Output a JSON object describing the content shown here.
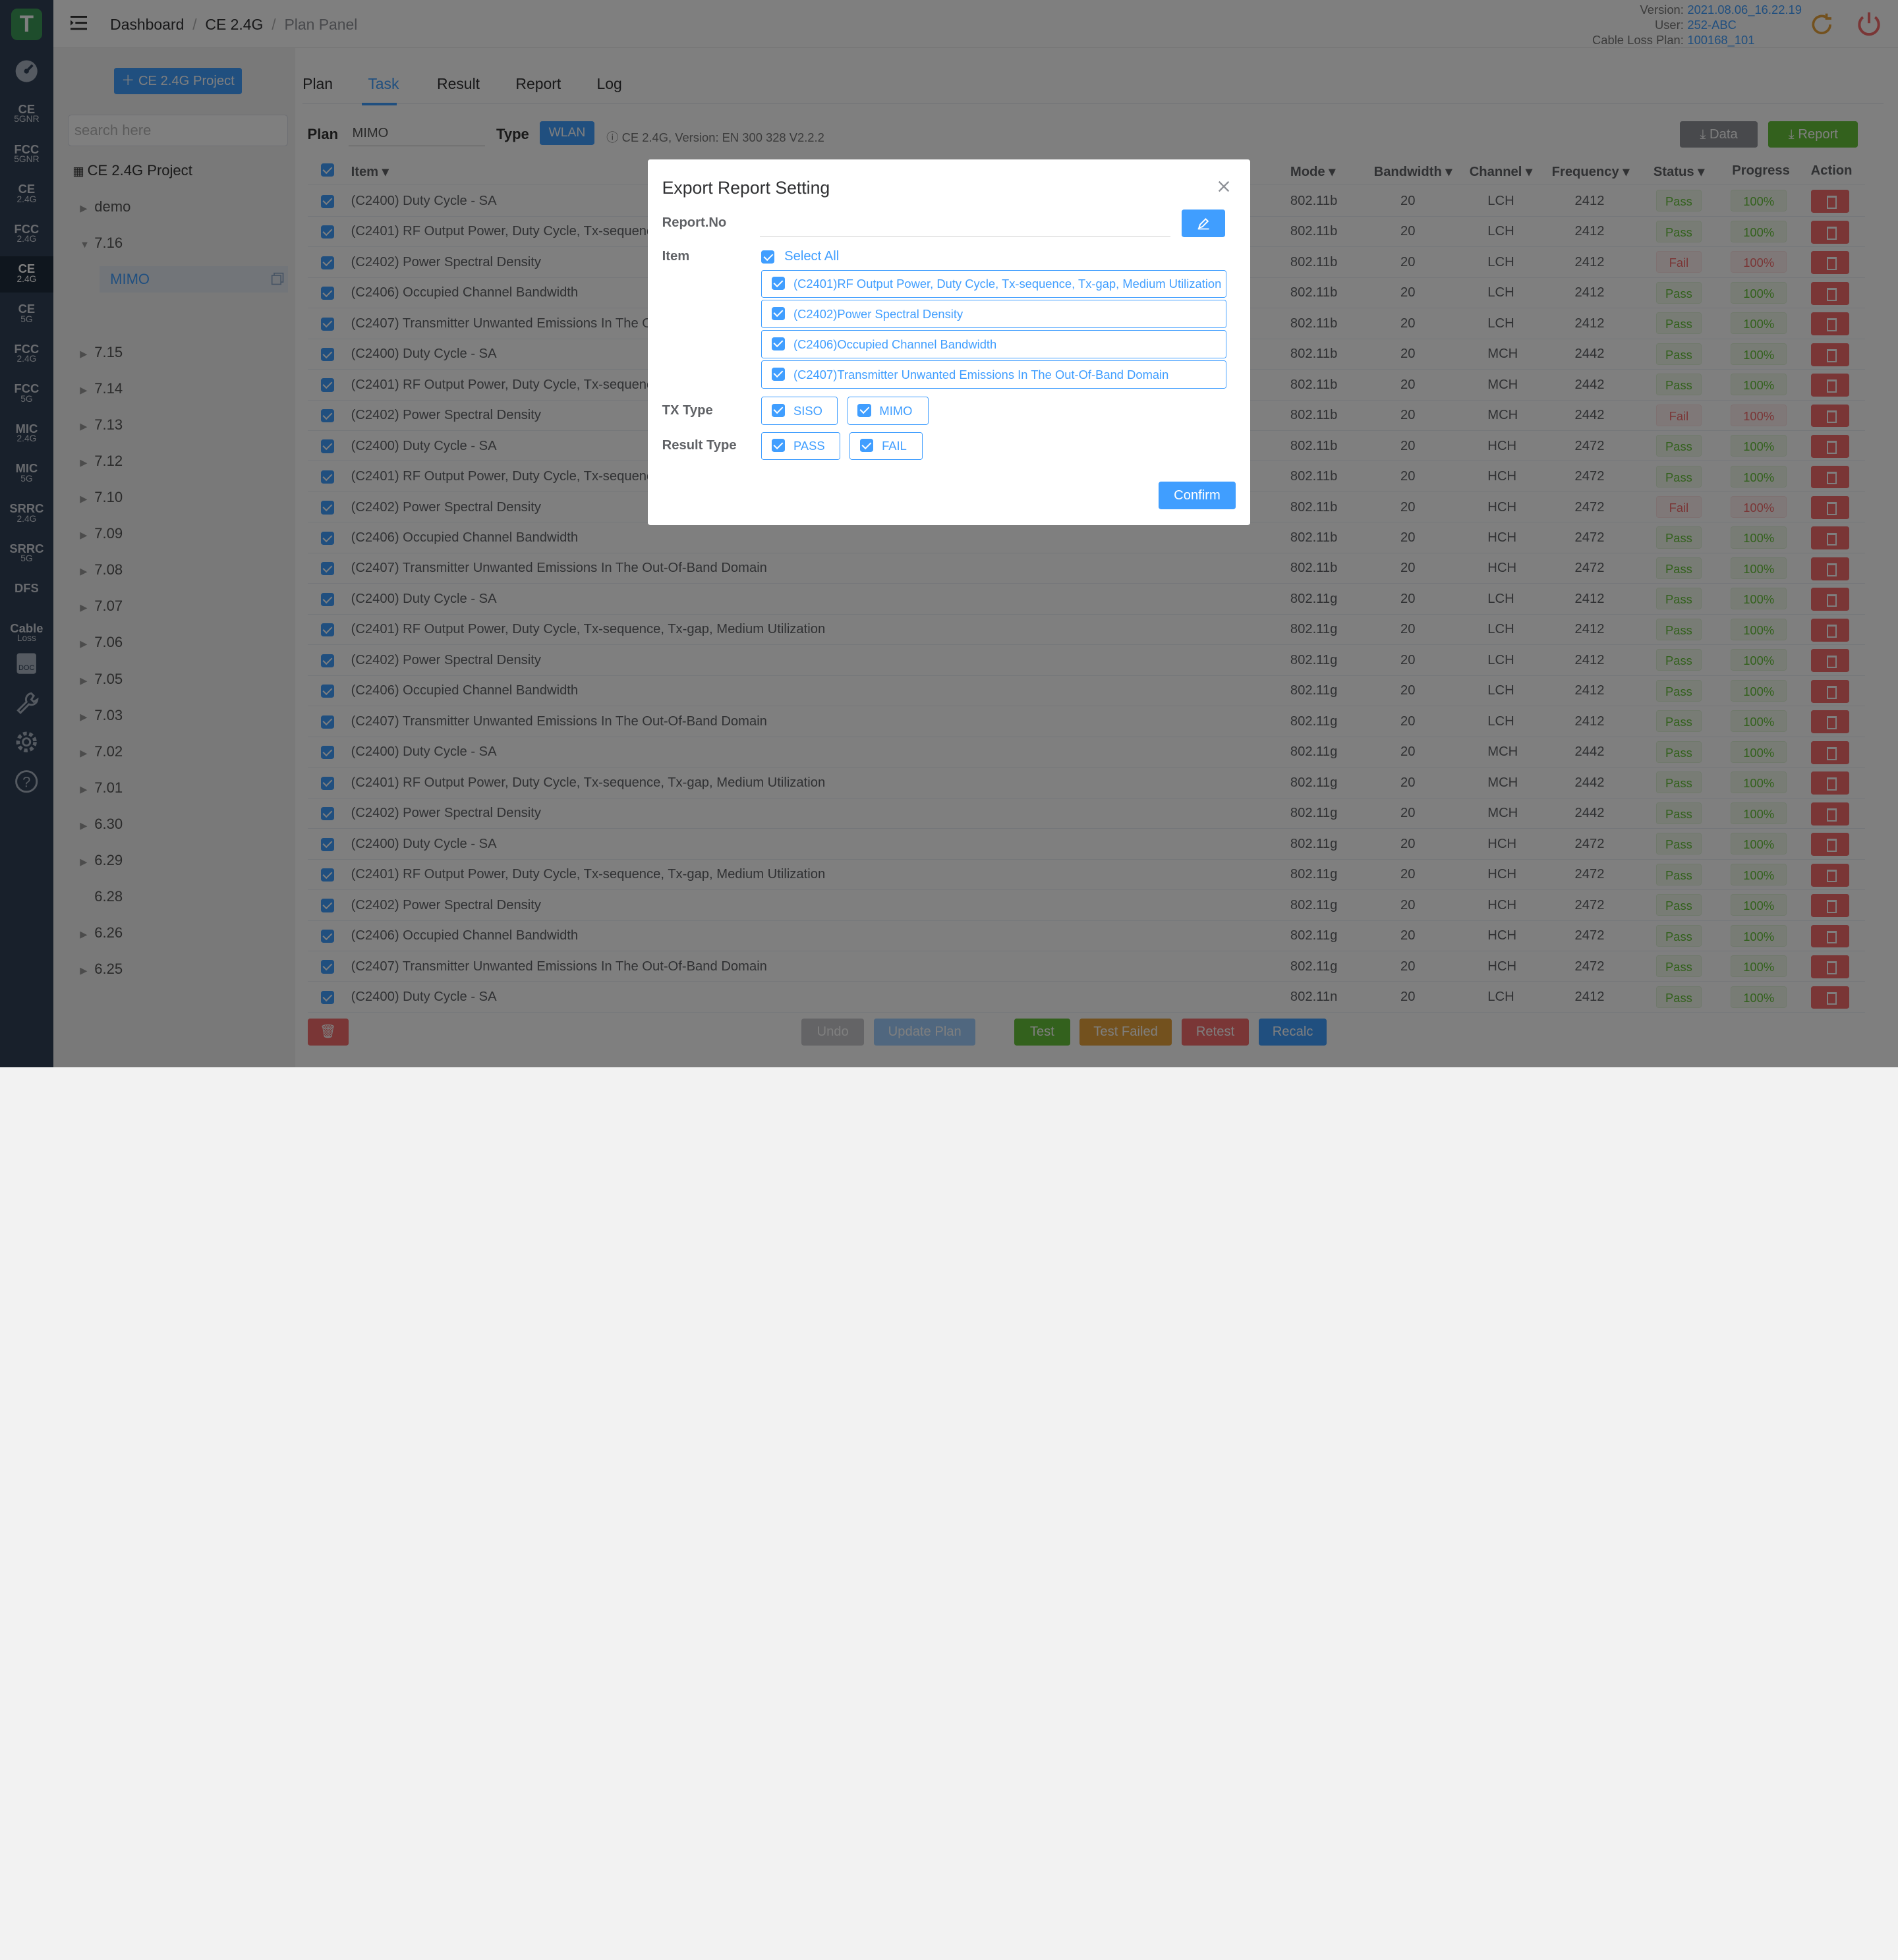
{
  "app": {
    "logo_letter": "T"
  },
  "rail": {
    "items": [
      {
        "main": "CE",
        "sub": "5GNR"
      },
      {
        "main": "FCC",
        "sub": "5GNR"
      },
      {
        "main": "CE",
        "sub": "2.4G"
      },
      {
        "main": "FCC",
        "sub": "2.4G"
      },
      {
        "main": "CE",
        "sub": "2.4G"
      },
      {
        "main": "CE",
        "sub": "5G"
      },
      {
        "main": "FCC",
        "sub": "2.4G"
      },
      {
        "main": "FCC",
        "sub": "5G"
      },
      {
        "main": "MIC",
        "sub": "2.4G"
      },
      {
        "main": "MIC",
        "sub": "5G"
      },
      {
        "main": "SRRC",
        "sub": "2.4G"
      },
      {
        "main": "SRRC",
        "sub": "5G"
      },
      {
        "main": "DFS",
        "sub": ""
      },
      {
        "main": "Cable",
        "sub": "Loss"
      }
    ],
    "active_index": 4,
    "icons": [
      "dashboard-icon",
      "doc-icon",
      "wrench-icon",
      "gear-icon",
      "help-icon"
    ]
  },
  "header": {
    "breadcrumb": [
      "Dashboard",
      "CE 2.4G",
      "Plan Panel"
    ],
    "version_label": "Version:",
    "version": "2021.08.06_16.22.19",
    "user_label": "User:",
    "user": "252-ABC",
    "cable_label": "Cable Loss Plan:",
    "cable": "100168_101"
  },
  "sidebar": {
    "project_button": "CE 2.4G Project",
    "search_placeholder": "search here",
    "tree_root": "CE 2.4G Project",
    "tree": [
      {
        "label": "demo",
        "expanded": false,
        "arrow": true
      },
      {
        "label": "7.16",
        "expanded": true,
        "arrow": true
      },
      {
        "label": "7.15",
        "arrow": true
      },
      {
        "label": "7.14",
        "arrow": true
      },
      {
        "label": "7.13",
        "arrow": true
      },
      {
        "label": "7.12",
        "arrow": true
      },
      {
        "label": "7.10",
        "arrow": true
      },
      {
        "label": "7.09",
        "arrow": true
      },
      {
        "label": "7.08",
        "arrow": true
      },
      {
        "label": "7.07",
        "arrow": true
      },
      {
        "label": "7.06",
        "arrow": true
      },
      {
        "label": "7.05",
        "arrow": true
      },
      {
        "label": "7.03",
        "arrow": true
      },
      {
        "label": "7.02",
        "arrow": true
      },
      {
        "label": "7.01",
        "arrow": true
      },
      {
        "label": "6.30",
        "arrow": true
      },
      {
        "label": "6.29",
        "arrow": true
      },
      {
        "label": "6.28",
        "arrow": false
      },
      {
        "label": "6.26",
        "arrow": true
      },
      {
        "label": "6.25",
        "arrow": true
      }
    ],
    "selected_child": "MIMO"
  },
  "tabs": [
    "Plan",
    "Task",
    "Result",
    "Report",
    "Log"
  ],
  "active_tab": "Task",
  "plan": {
    "plan_label": "Plan",
    "plan_value": "MIMO",
    "type_label": "Type",
    "type_value": "WLAN",
    "info": "CE 2.4G, Version: EN 300 328 V2.2.2"
  },
  "buttons": {
    "data": "Data",
    "report": "Report"
  },
  "table": {
    "columns": {
      "item": "Item",
      "mode": "Mode",
      "bandwidth": "Bandwidth",
      "channel": "Channel",
      "frequency": "Frequency",
      "status": "Status",
      "progress": "Progress",
      "action": "Action"
    },
    "rows": [
      {
        "item": "(C2400) Duty Cycle - SA",
        "mode": "802.11b",
        "bw": "20",
        "ch": "LCH",
        "freq": "2412",
        "status": "Pass",
        "progress": "100%"
      },
      {
        "item": "(C2401) RF Output Power, Duty Cycle, Tx-sequence, Tx-gap, Medium Utilization",
        "mode": "802.11b",
        "bw": "20",
        "ch": "LCH",
        "freq": "2412",
        "status": "Pass",
        "progress": "100%"
      },
      {
        "item": "(C2402) Power Spectral Density",
        "mode": "802.11b",
        "bw": "20",
        "ch": "LCH",
        "freq": "2412",
        "status": "Fail",
        "progress": "100%"
      },
      {
        "item": "(C2406) Occupied Channel Bandwidth",
        "mode": "802.11b",
        "bw": "20",
        "ch": "LCH",
        "freq": "2412",
        "status": "Pass",
        "progress": "100%"
      },
      {
        "item": "(C2407) Transmitter Unwanted Emissions In The Out-Of-Band Domain",
        "mode": "802.11b",
        "bw": "20",
        "ch": "LCH",
        "freq": "2412",
        "status": "Pass",
        "progress": "100%"
      },
      {
        "item": "(C2400) Duty Cycle - SA",
        "mode": "802.11b",
        "bw": "20",
        "ch": "MCH",
        "freq": "2442",
        "status": "Pass",
        "progress": "100%"
      },
      {
        "item": "(C2401) RF Output Power, Duty Cycle, Tx-sequence, Tx-gap, Medium Utilization",
        "mode": "802.11b",
        "bw": "20",
        "ch": "MCH",
        "freq": "2442",
        "status": "Pass",
        "progress": "100%"
      },
      {
        "item": "(C2402) Power Spectral Density",
        "mode": "802.11b",
        "bw": "20",
        "ch": "MCH",
        "freq": "2442",
        "status": "Fail",
        "progress": "100%"
      },
      {
        "item": "(C2400) Duty Cycle - SA",
        "mode": "802.11b",
        "bw": "20",
        "ch": "HCH",
        "freq": "2472",
        "status": "Pass",
        "progress": "100%"
      },
      {
        "item": "(C2401) RF Output Power, Duty Cycle, Tx-sequence, Tx-gap, Medium Utilization",
        "mode": "802.11b",
        "bw": "20",
        "ch": "HCH",
        "freq": "2472",
        "status": "Pass",
        "progress": "100%"
      },
      {
        "item": "(C2402) Power Spectral Density",
        "mode": "802.11b",
        "bw": "20",
        "ch": "HCH",
        "freq": "2472",
        "status": "Fail",
        "progress": "100%"
      },
      {
        "item": "(C2406) Occupied Channel Bandwidth",
        "mode": "802.11b",
        "bw": "20",
        "ch": "HCH",
        "freq": "2472",
        "status": "Pass",
        "progress": "100%"
      },
      {
        "item": "(C2407) Transmitter Unwanted Emissions In The Out-Of-Band Domain",
        "mode": "802.11b",
        "bw": "20",
        "ch": "HCH",
        "freq": "2472",
        "status": "Pass",
        "progress": "100%"
      },
      {
        "item": "(C2400) Duty Cycle - SA",
        "mode": "802.11g",
        "bw": "20",
        "ch": "LCH",
        "freq": "2412",
        "status": "Pass",
        "progress": "100%"
      },
      {
        "item": "(C2401) RF Output Power, Duty Cycle, Tx-sequence, Tx-gap, Medium Utilization",
        "mode": "802.11g",
        "bw": "20",
        "ch": "LCH",
        "freq": "2412",
        "status": "Pass",
        "progress": "100%"
      },
      {
        "item": "(C2402) Power Spectral Density",
        "mode": "802.11g",
        "bw": "20",
        "ch": "LCH",
        "freq": "2412",
        "status": "Pass",
        "progress": "100%"
      },
      {
        "item": "(C2406) Occupied Channel Bandwidth",
        "mode": "802.11g",
        "bw": "20",
        "ch": "LCH",
        "freq": "2412",
        "status": "Pass",
        "progress": "100%"
      },
      {
        "item": "(C2407) Transmitter Unwanted Emissions In The Out-Of-Band Domain",
        "mode": "802.11g",
        "bw": "20",
        "ch": "LCH",
        "freq": "2412",
        "status": "Pass",
        "progress": "100%"
      },
      {
        "item": "(C2400) Duty Cycle - SA",
        "mode": "802.11g",
        "bw": "20",
        "ch": "MCH",
        "freq": "2442",
        "status": "Pass",
        "progress": "100%"
      },
      {
        "item": "(C2401) RF Output Power, Duty Cycle, Tx-sequence, Tx-gap, Medium Utilization",
        "mode": "802.11g",
        "bw": "20",
        "ch": "MCH",
        "freq": "2442",
        "status": "Pass",
        "progress": "100%"
      },
      {
        "item": "(C2402) Power Spectral Density",
        "mode": "802.11g",
        "bw": "20",
        "ch": "MCH",
        "freq": "2442",
        "status": "Pass",
        "progress": "100%"
      },
      {
        "item": "(C2400) Duty Cycle - SA",
        "mode": "802.11g",
        "bw": "20",
        "ch": "HCH",
        "freq": "2472",
        "status": "Pass",
        "progress": "100%"
      },
      {
        "item": "(C2401) RF Output Power, Duty Cycle, Tx-sequence, Tx-gap, Medium Utilization",
        "mode": "802.11g",
        "bw": "20",
        "ch": "HCH",
        "freq": "2472",
        "status": "Pass",
        "progress": "100%"
      },
      {
        "item": "(C2402) Power Spectral Density",
        "mode": "802.11g",
        "bw": "20",
        "ch": "HCH",
        "freq": "2472",
        "status": "Pass",
        "progress": "100%"
      },
      {
        "item": "(C2406) Occupied Channel Bandwidth",
        "mode": "802.11g",
        "bw": "20",
        "ch": "HCH",
        "freq": "2472",
        "status": "Pass",
        "progress": "100%"
      },
      {
        "item": "(C2407) Transmitter Unwanted Emissions In The Out-Of-Band Domain",
        "mode": "802.11g",
        "bw": "20",
        "ch": "HCH",
        "freq": "2472",
        "status": "Pass",
        "progress": "100%"
      },
      {
        "item": "(C2400) Duty Cycle - SA",
        "mode": "802.11n",
        "bw": "20",
        "ch": "LCH",
        "freq": "2412",
        "status": "Pass",
        "progress": "100%"
      }
    ]
  },
  "footer": {
    "undo": "Undo",
    "update_plan": "Update Plan",
    "test": "Test",
    "test_failed": "Test Failed",
    "retest": "Retest",
    "recalc": "Recalc"
  },
  "modal": {
    "title": "Export Report Setting",
    "report_no_label": "Report.No",
    "report_no_value": "",
    "item_label": "Item",
    "select_all": "Select All",
    "items": [
      "(C2401)RF Output Power, Duty Cycle, Tx-sequence, Tx-gap, Medium Utilization",
      "(C2402)Power Spectral Density",
      "(C2406)Occupied Channel Bandwidth",
      "(C2407)Transmitter Unwanted Emissions In The Out-Of-Band Domain"
    ],
    "tx_type_label": "TX Type",
    "tx_types": [
      "SISO",
      "MIMO"
    ],
    "result_type_label": "Result Type",
    "result_types": [
      "PASS",
      "FAIL"
    ],
    "confirm": "Confirm"
  },
  "colors": {
    "primary": "#409eff",
    "success": "#67c23a",
    "danger": "#f56c6c",
    "warning": "#e6a23c",
    "rail": "#304156"
  }
}
